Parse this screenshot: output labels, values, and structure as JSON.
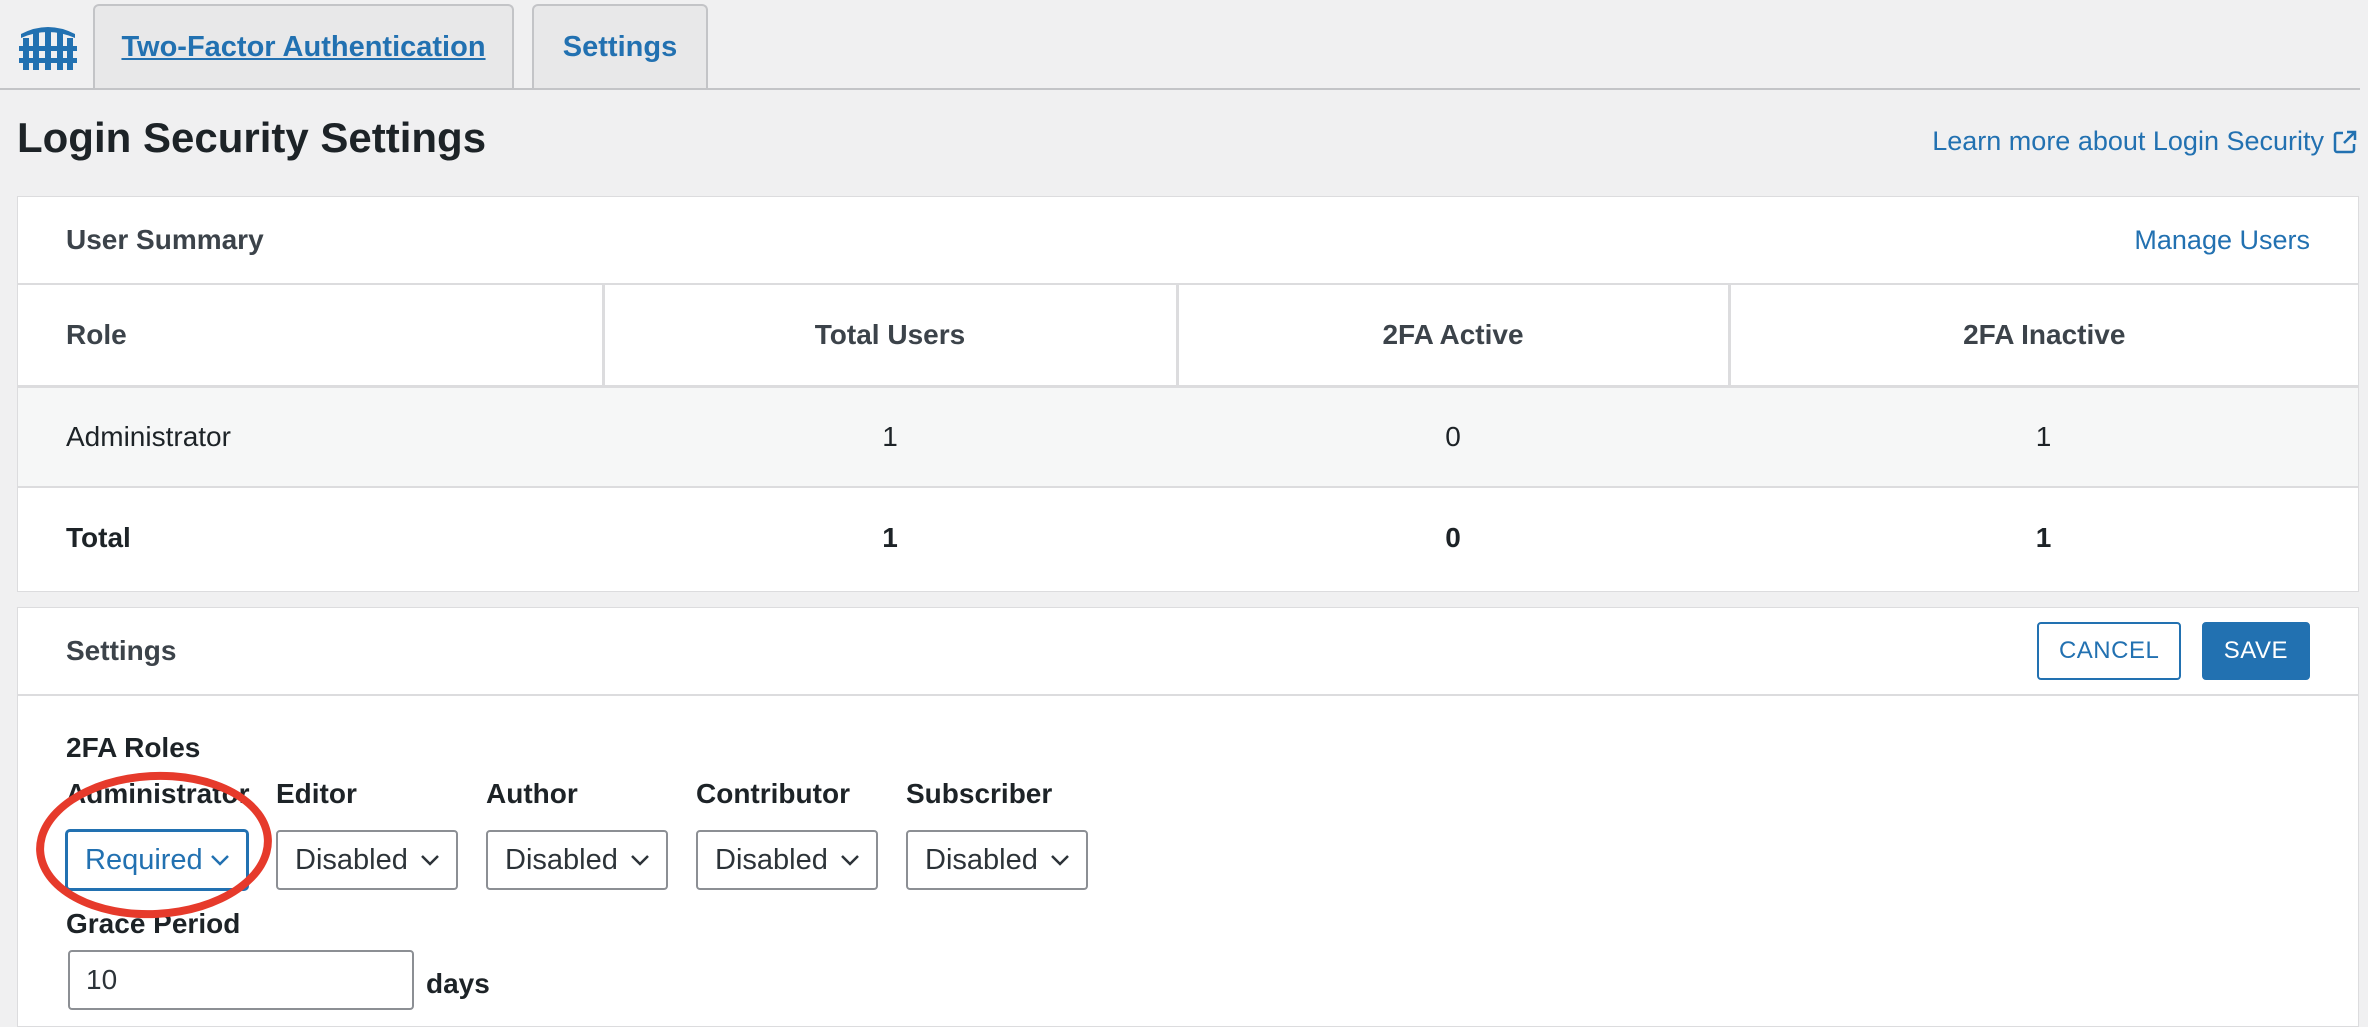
{
  "tabs": [
    {
      "label": "Two-Factor Authentication",
      "active": false
    },
    {
      "label": "Settings",
      "active": true
    }
  ],
  "header": {
    "title": "Login Security Settings",
    "learn_more": "Learn more about Login Security"
  },
  "user_summary": {
    "title": "User Summary",
    "manage_link": "Manage Users",
    "columns": [
      "Role",
      "Total Users",
      "2FA Active",
      "2FA Inactive"
    ],
    "rows": [
      {
        "role": "Administrator",
        "total": "1",
        "active": "0",
        "inactive": "1"
      }
    ],
    "total_row": {
      "role": "Total",
      "total": "1",
      "active": "0",
      "inactive": "1"
    }
  },
  "settings": {
    "title": "Settings",
    "cancel_label": "CANCEL",
    "save_label": "SAVE",
    "roles_title": "2FA Roles",
    "roles": [
      {
        "label": "Administrator",
        "value": "Required"
      },
      {
        "label": "Editor",
        "value": "Disabled"
      },
      {
        "label": "Author",
        "value": "Disabled"
      },
      {
        "label": "Contributor",
        "value": "Disabled"
      },
      {
        "label": "Subscriber",
        "value": "Disabled"
      }
    ],
    "grace_period_label": "Grace Period",
    "grace_period_value": "10",
    "grace_period_unit": "days"
  },
  "colors": {
    "accent": "#2271b1",
    "annotation": "#e63a2b",
    "background": "#f0f0f1"
  },
  "icons": {
    "logo": "wordfence-logo-icon",
    "external": "external-link-icon",
    "chevron": "chevron-down-icon"
  }
}
